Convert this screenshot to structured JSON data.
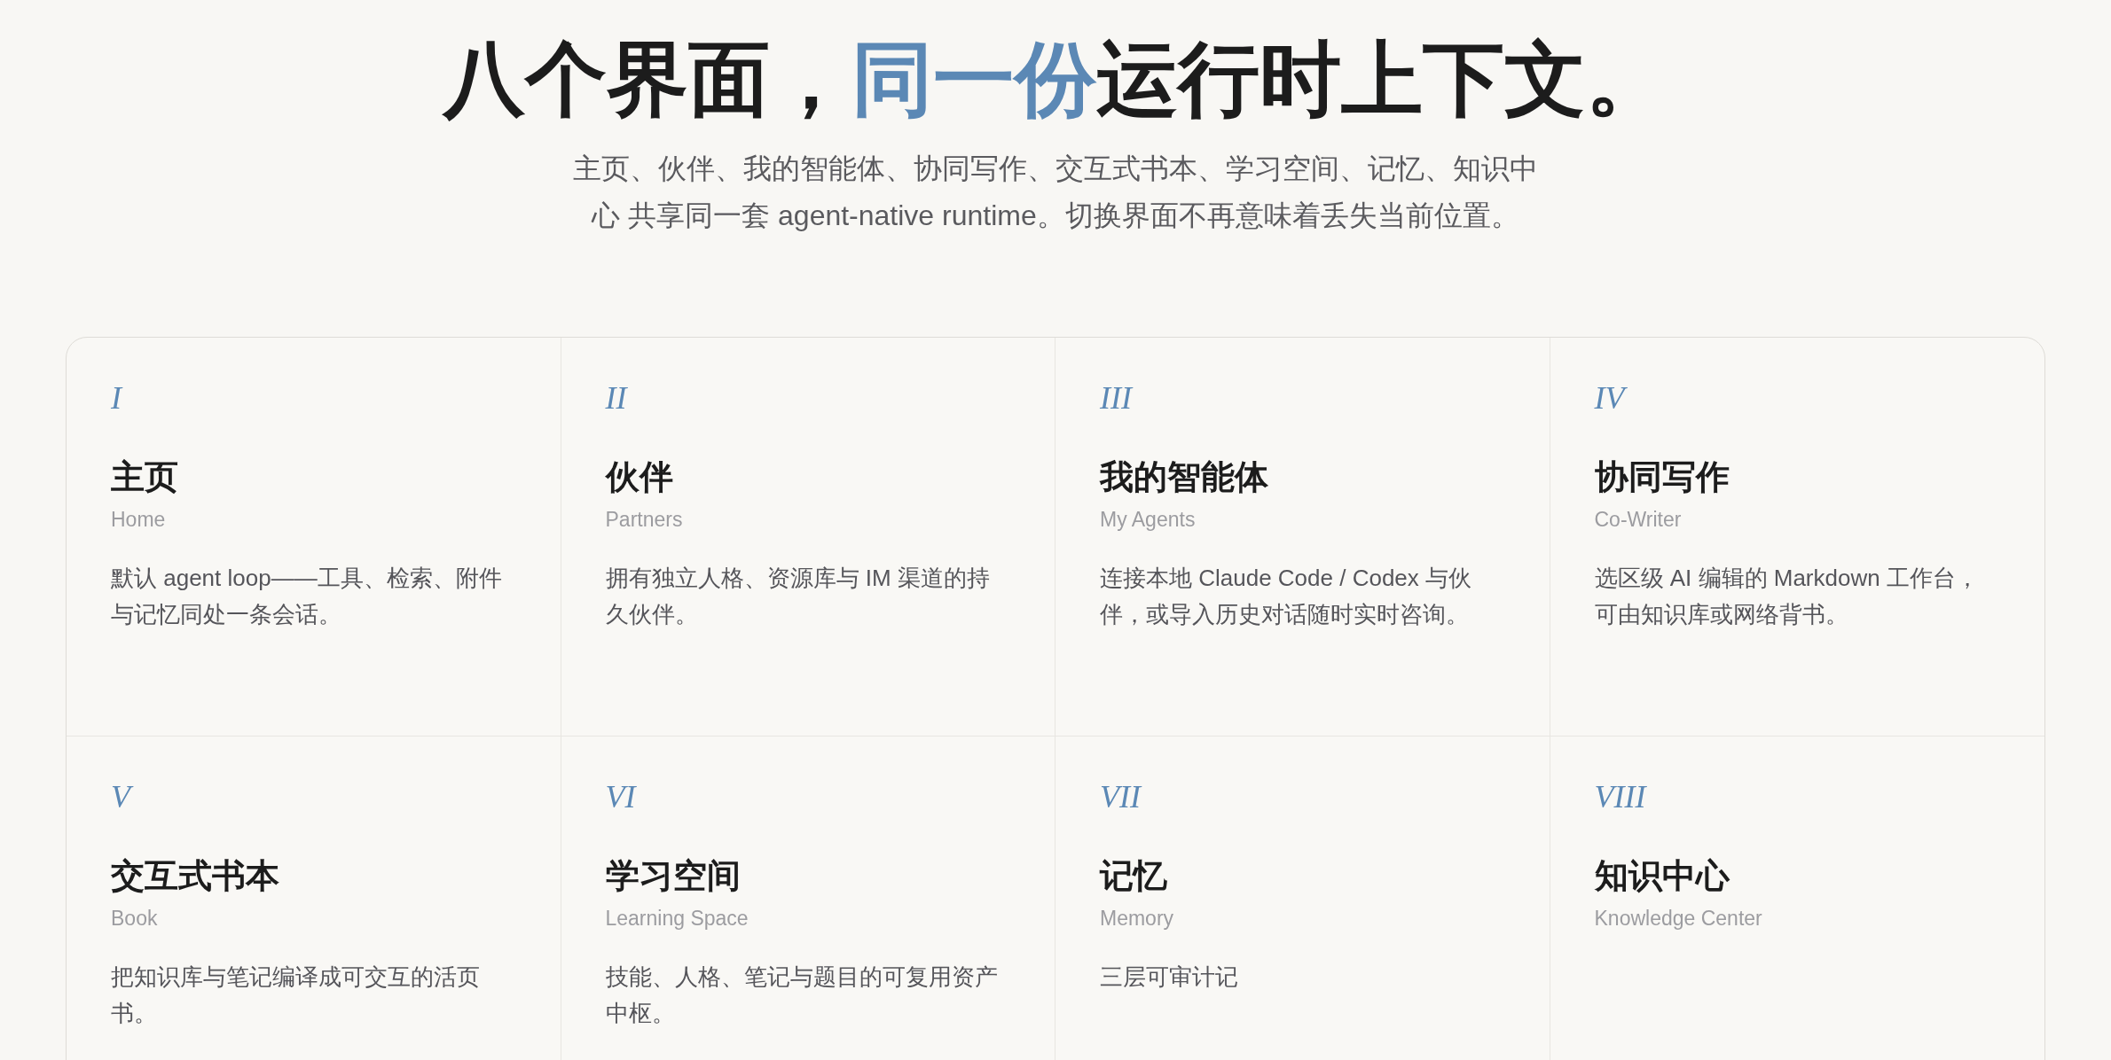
{
  "heading": [
    {
      "text": "八个界面，",
      "accent": false
    },
    {
      "text": "同一份",
      "accent": true
    },
    {
      "text": "运行时上下文。",
      "accent": false
    }
  ],
  "subtitle": "主页、伙伴、我的智能体、协同写作、交互式书本、学习空间、记忆、知识中心 共享同一套 agent-native runtime。切换界面不再意味着丢失当前位置。",
  "surfaces": [
    {
      "numeral": "I",
      "title": "主页",
      "subtitle": "Home",
      "description": "默认 agent loop——工具、检索、附件与记忆同处一条会话。"
    },
    {
      "numeral": "II",
      "title": "伙伴",
      "subtitle": "Partners",
      "description": "拥有独立人格、资源库与 IM 渠道的持久伙伴。"
    },
    {
      "numeral": "III",
      "title": "我的智能体",
      "subtitle": "My Agents",
      "description": "连接本地 Claude Code / Codex 与伙伴，或导入历史对话随时实时咨询。"
    },
    {
      "numeral": "IV",
      "title": "协同写作",
      "subtitle": "Co-Writer",
      "description": "选区级 AI 编辑的 Markdown 工作台，可由知识库或网络背书。"
    },
    {
      "numeral": "V",
      "title": "交互式书本",
      "subtitle": "Book",
      "description": "把知识库与笔记编译成可交互的活页书。"
    },
    {
      "numeral": "VI",
      "title": "学习空间",
      "subtitle": "Learning Space",
      "description": "技能、人格、笔记与题目的可复用资产中枢。"
    },
    {
      "numeral": "VII",
      "title": "记忆",
      "subtitle": "Memory",
      "description": "三层可审计记"
    },
    {
      "numeral": "VIII",
      "title": "知识中心",
      "subtitle": "Knowledge Center"
    }
  ]
}
